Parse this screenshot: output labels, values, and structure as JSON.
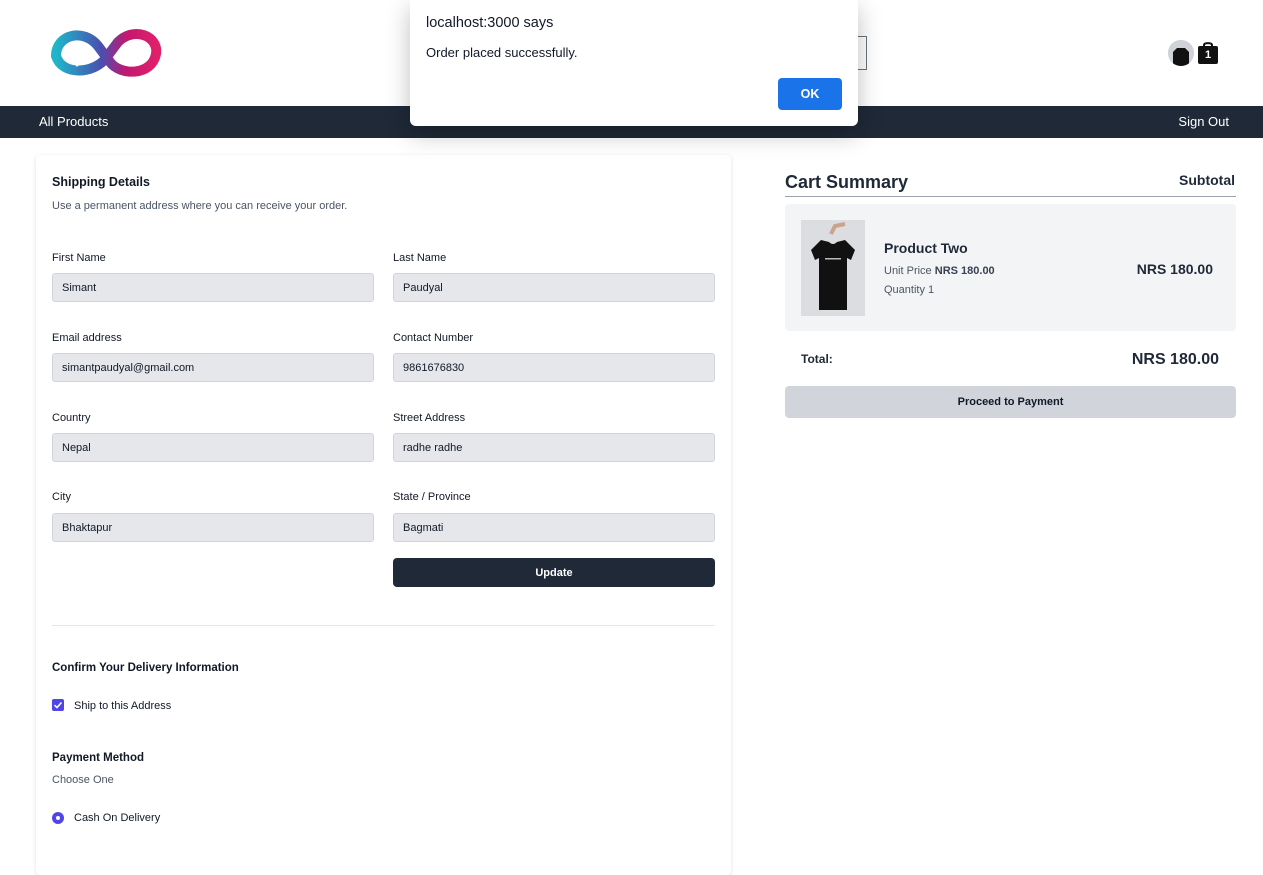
{
  "header": {
    "logo": "infinity-logo",
    "cart_count": "1"
  },
  "nav": {
    "all_products": "All Products",
    "sign_out": "Sign Out"
  },
  "shipping": {
    "title": "Shipping Details",
    "subtitle": "Use a permanent address where you can receive your order.",
    "fields": {
      "first_name": {
        "label": "First Name",
        "value": "Simant"
      },
      "last_name": {
        "label": "Last Name",
        "value": "Paudyal"
      },
      "email": {
        "label": "Email address",
        "value": "simantpaudyal@gmail.com"
      },
      "contact": {
        "label": "Contact Number",
        "value": "9861676830"
      },
      "country": {
        "label": "Country",
        "value": "Nepal"
      },
      "street": {
        "label": "Street Address",
        "value": "radhe radhe"
      },
      "city": {
        "label": "City",
        "value": "Bhaktapur"
      },
      "state": {
        "label": "State / Province",
        "value": "Bagmati"
      }
    },
    "update_label": "Update",
    "confirm_title": "Confirm Your Delivery Information",
    "ship_to_address_label": "Ship to this Address",
    "ship_to_address_checked": true,
    "payment_title": "Payment Method",
    "payment_subtitle": "Choose One",
    "payment_option": "Cash On Delivery"
  },
  "summary": {
    "title": "Cart Summary",
    "subtotal_label": "Subtotal",
    "item": {
      "name": "Product Two",
      "unit_price_label": "Unit Price",
      "unit_price": "NRS 180.00",
      "quantity_text": "Quantity 1",
      "price": "NRS 180.00"
    },
    "total_label": "Total:",
    "total_value": "NRS 180.00",
    "pay_label": "Proceed to Payment"
  },
  "dialog": {
    "title": "localhost:3000 says",
    "message": "Order placed successfully.",
    "ok_label": "OK"
  },
  "colors": {
    "nav_bg": "#1f2937",
    "accent": "#4f46e5",
    "dialog_button": "#1a73e8"
  }
}
